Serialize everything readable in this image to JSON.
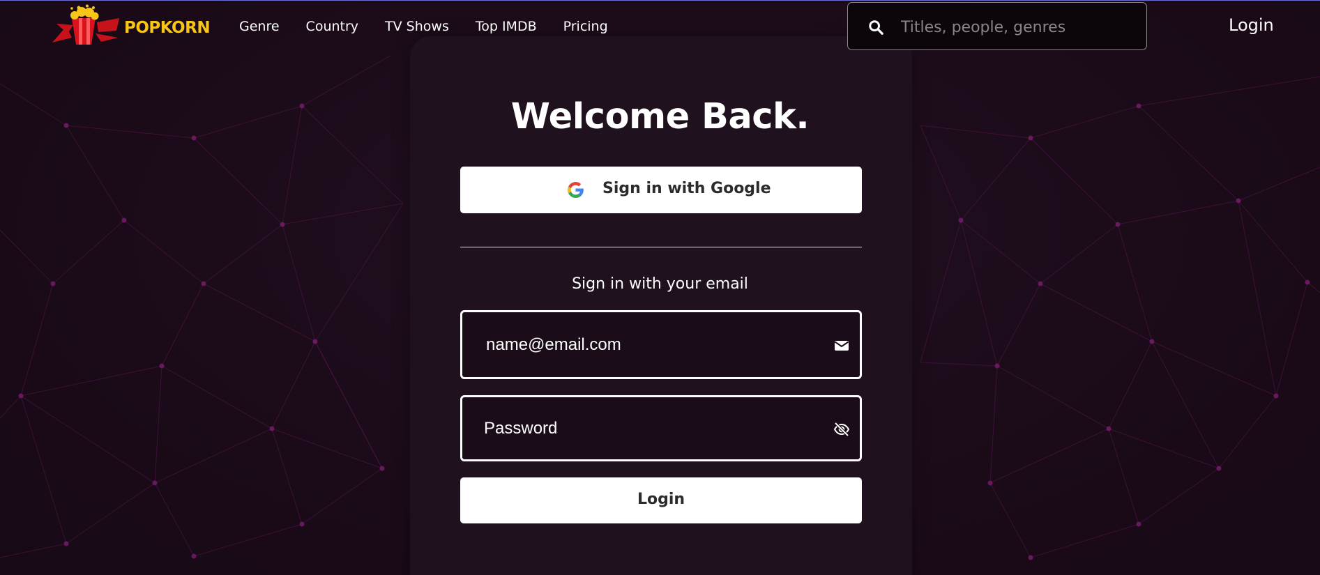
{
  "header": {
    "logo_text": "POPKORN",
    "nav": [
      {
        "label": "Genre"
      },
      {
        "label": "Country"
      },
      {
        "label": "TV Shows"
      },
      {
        "label": "Top IMDB"
      },
      {
        "label": "Pricing"
      }
    ],
    "search": {
      "placeholder": "Titles, people, genres",
      "value": ""
    },
    "login_label": "Login"
  },
  "form": {
    "title": "Welcome Back.",
    "google_label": "Sign in with Google",
    "email_section_label": "Sign in with your email",
    "email": {
      "placeholder": "name@email.com",
      "value": ""
    },
    "password": {
      "placeholder": "Password",
      "value": ""
    },
    "submit_label": "Login"
  },
  "colors": {
    "background": "#1d0d1b",
    "card": "#1f111e",
    "network_lines": "#5a1552",
    "brand_yellow": "#f7c618",
    "brand_red": "#d8131c"
  }
}
